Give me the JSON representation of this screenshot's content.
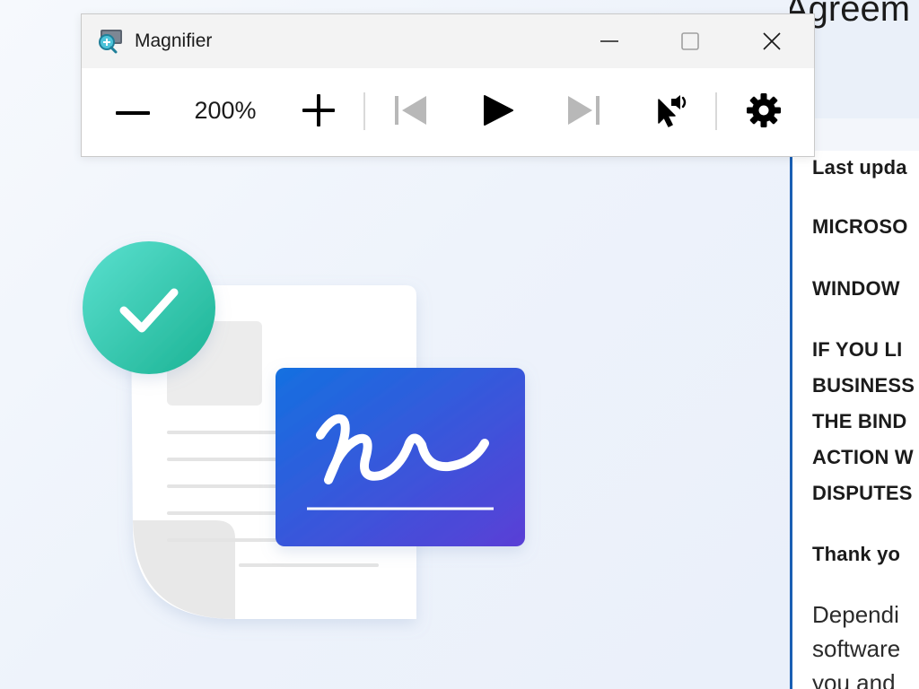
{
  "magnifier": {
    "title": "Magnifier",
    "zoom_level": "200%",
    "icons": {
      "app": "magnifier-app-icon",
      "minimize": "minimize-icon",
      "maximize": "maximize-icon",
      "close": "close-icon",
      "zoom_out": "minus-icon",
      "zoom_in": "plus-icon",
      "previous": "skip-previous-icon",
      "play": "play-icon",
      "next": "skip-next-icon",
      "read_from_pointer": "read-from-pointer-icon",
      "settings": "gear-icon"
    }
  },
  "license": {
    "title": "Agreem",
    "lines": [
      "Last upda",
      "MICROSO",
      "WINDOW",
      "IF YOU LI",
      "BUSINESS",
      "THE BIND",
      "ACTION W",
      "DISPUTES",
      "Thank yo"
    ],
    "paragraph": [
      "Dependi",
      "software",
      "you and"
    ]
  },
  "colors": {
    "accent_blue": "#1a5fb4",
    "check_teal": "#2fc6b0",
    "signature_card_start": "#1570e0",
    "signature_card_end": "#5a3fd6"
  }
}
